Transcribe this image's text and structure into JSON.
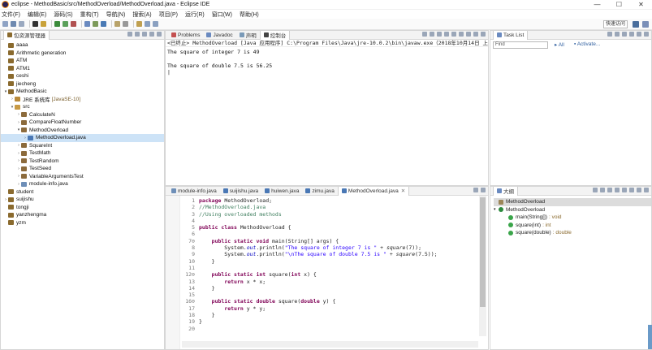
{
  "window": {
    "title": "eclipse - MethodBasic/src/MethodOverload/MethodOverload.java - Eclipse IDE",
    "controls": [
      "—",
      "☐",
      "✕"
    ]
  },
  "menu": [
    "文件(F)",
    "编辑(E)",
    "源码(S)",
    "重构(T)",
    "导航(N)",
    "搜索(A)",
    "项目(P)",
    "运行(R)",
    "窗口(W)",
    "帮助(H)"
  ],
  "toolbar": {
    "quick_access": "快速访问"
  },
  "package_explorer": {
    "tab_label": "包资源管理器",
    "items": [
      {
        "label": "aaaa",
        "indent": 0,
        "arrow": "",
        "icon": "project-icon"
      },
      {
        "label": "Arithmetic generation",
        "indent": 0,
        "arrow": "",
        "icon": "project-icon"
      },
      {
        "label": "ATM",
        "indent": 0,
        "arrow": "",
        "icon": "project-icon"
      },
      {
        "label": "ATM1",
        "indent": 0,
        "arrow": "",
        "icon": "project-icon"
      },
      {
        "label": "ceshi",
        "indent": 0,
        "arrow": "",
        "icon": "project-icon"
      },
      {
        "label": "jiecheng",
        "indent": 0,
        "arrow": "",
        "icon": "project-icon"
      },
      {
        "label": "MethodBasic",
        "indent": 0,
        "arrow": "▾",
        "icon": "project-icon"
      },
      {
        "label": "JRE 系统库",
        "decor": "[JavaSE-10]",
        "indent": 1,
        "arrow": "›",
        "icon": "library-icon"
      },
      {
        "label": "src",
        "indent": 1,
        "arrow": "▾",
        "icon": "source-folder-icon"
      },
      {
        "label": "CalculateN",
        "indent": 2,
        "arrow": "›",
        "icon": "package-icon"
      },
      {
        "label": "CompareFloatNumber",
        "indent": 2,
        "arrow": "›",
        "icon": "package-icon"
      },
      {
        "label": "MethodOverload",
        "indent": 2,
        "arrow": "▾",
        "icon": "package-icon"
      },
      {
        "label": "MethodOverload.java",
        "indent": 3,
        "arrow": "›",
        "icon": "java-file-icon",
        "selected": true
      },
      {
        "label": "SquareInt",
        "indent": 2,
        "arrow": "›",
        "icon": "package-icon"
      },
      {
        "label": "TestMath",
        "indent": 2,
        "arrow": "›",
        "icon": "package-icon"
      },
      {
        "label": "TestRandom",
        "indent": 2,
        "arrow": "›",
        "icon": "package-icon"
      },
      {
        "label": "TestSeed",
        "indent": 2,
        "arrow": "›",
        "icon": "package-icon"
      },
      {
        "label": "VariableArgumentsTest",
        "indent": 2,
        "arrow": "›",
        "icon": "package-icon"
      },
      {
        "label": "module-info.java",
        "indent": 2,
        "arrow": "›",
        "icon": "module-info-icon"
      },
      {
        "label": "student",
        "indent": 0,
        "arrow": "",
        "icon": "project-icon"
      },
      {
        "label": "suijishu",
        "indent": 0,
        "arrow": "›",
        "icon": "project-icon"
      },
      {
        "label": "tongji",
        "indent": 0,
        "arrow": "",
        "icon": "project-icon"
      },
      {
        "label": "yanzhengma",
        "indent": 0,
        "arrow": "",
        "icon": "project-icon"
      },
      {
        "label": "yzm",
        "indent": 0,
        "arrow": "",
        "icon": "project-icon"
      }
    ]
  },
  "console": {
    "tabs": [
      {
        "label": "Problems",
        "active": false
      },
      {
        "label": "Javadoc",
        "active": false
      },
      {
        "label": "声明",
        "active": false
      },
      {
        "label": "控制台",
        "active": true
      }
    ],
    "status": "<已终止> MethodOverload [Java 应用程序] C:\\Program Files\\Java\\jre-10.0.2\\bin\\javaw.exe（2018年10月14日 上午10:57:55）",
    "output": [
      "The square of integer 7 is 49",
      "",
      "The square of double 7.5 is 56.25",
      "|"
    ]
  },
  "editor": {
    "tabs": [
      {
        "label": "module-info.java",
        "active": false
      },
      {
        "label": "suijishu.java",
        "active": false
      },
      {
        "label": "huiwen.java",
        "active": false
      },
      {
        "label": "zimu.java",
        "active": false
      },
      {
        "label": "MethodOverload.java",
        "active": true
      }
    ],
    "line_numbers": [
      "1",
      "2",
      "3",
      "4",
      "5",
      "6",
      "7⊖",
      "8",
      "9",
      "10",
      "11",
      "12⊖",
      "13",
      "14",
      "15",
      "16⊖",
      "17",
      "18",
      "19",
      "20"
    ]
  },
  "task_list": {
    "tab_label": "Task List",
    "find_placeholder": "Find",
    "all_label": "All",
    "activate_label": "Activate..."
  },
  "outline": {
    "tab_label": "大纲",
    "items": [
      {
        "label": "MethodOverload",
        "indent": 0,
        "icon": "package-icon",
        "selected": true
      },
      {
        "label": "MethodOverload",
        "indent": 0,
        "icon": "class-icon",
        "arrow": "▾"
      },
      {
        "label": "main(String[])",
        "rtype": ": void",
        "indent": 1,
        "icon": "method-icon"
      },
      {
        "label": "square(int)",
        "rtype": ": int",
        "indent": 1,
        "icon": "method-icon"
      },
      {
        "label": "square(double)",
        "rtype": ": double",
        "indent": 1,
        "icon": "method-icon"
      }
    ]
  },
  "colors": {
    "keyword": "#7f0055",
    "comment": "#3f7f5f",
    "string": "#2a00ff",
    "selection": "#cde3f7"
  }
}
